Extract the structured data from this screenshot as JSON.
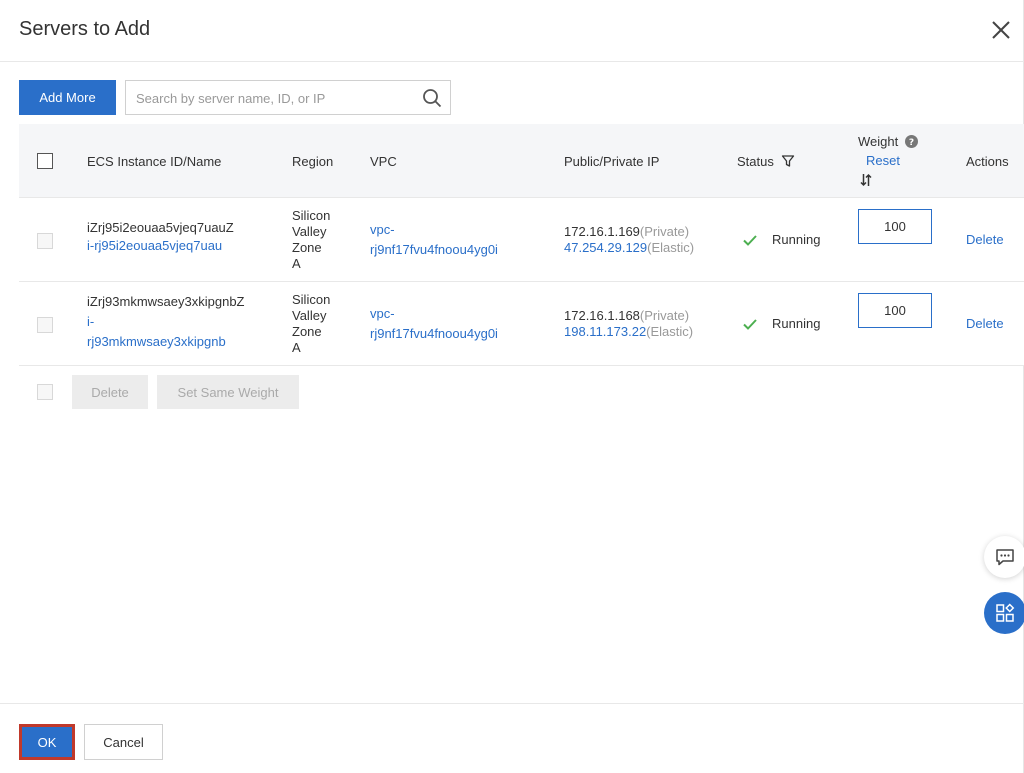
{
  "dialog": {
    "title": "Servers to Add"
  },
  "toolbar": {
    "add_more_label": "Add More",
    "search_placeholder": "Search by server name, ID, or IP"
  },
  "table": {
    "headers": {
      "instance": "ECS Instance ID/Name",
      "region": "Region",
      "vpc": "VPC",
      "ip": "Public/Private IP",
      "status": "Status",
      "weight": "Weight",
      "weight_reset": "Reset",
      "actions": "Actions"
    },
    "rows": [
      {
        "name": "iZrj95i2eouaa5vjeq7uauZ",
        "id": "i-rj95i2eouaa5vjeq7uau",
        "region": [
          "Silicon",
          "Valley",
          "Zone",
          "A"
        ],
        "vpc": [
          "vpc-",
          "rj9nf17fvu4fnoou4yg0i"
        ],
        "private_ip": "172.16.1.169",
        "private_label": "(Private)",
        "public_ip": "47.254.29.129",
        "public_label": "(Elastic)",
        "status": "Running",
        "weight": "100",
        "action": "Delete"
      },
      {
        "name": "iZrj93mkmwsaey3xkipgnbZ",
        "id": [
          "i-",
          "rj93mkmwsaey3xkipgnb"
        ],
        "region": [
          "Silicon",
          "Valley",
          "Zone",
          "A"
        ],
        "vpc": [
          "vpc-",
          "rj9nf17fvu4fnoou4yg0i"
        ],
        "private_ip": "172.16.1.168",
        "private_label": "(Private)",
        "public_ip": "198.11.173.22",
        "public_label": "(Elastic)",
        "status": "Running",
        "weight": "100",
        "action": "Delete"
      }
    ]
  },
  "bulk_actions": {
    "delete_label": "Delete",
    "set_weight_label": "Set Same Weight"
  },
  "footer": {
    "ok_label": "OK",
    "cancel_label": "Cancel"
  },
  "colors": {
    "primary": "#2a6fc9",
    "running": "#4caf50",
    "ok_highlight": "#c0392b"
  },
  "icons": {
    "close": "close-icon",
    "search": "search-icon",
    "help": "help-circle-icon",
    "filter": "filter-icon",
    "sort": "sort-icon",
    "check": "check-icon",
    "chat": "chat-icon",
    "apps": "apps-icon"
  }
}
